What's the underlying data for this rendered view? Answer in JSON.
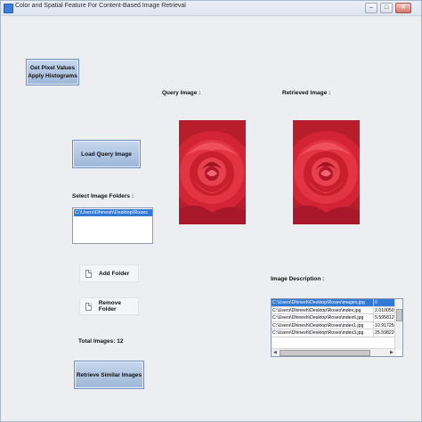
{
  "window": {
    "title": "Color and Spatial Feature For Content-Based Image Retrieval",
    "controls": {
      "minimize": "–",
      "maximize": "□",
      "close": "✕"
    }
  },
  "buttons": {
    "get_pixel_line1": "Get Pixel Values",
    "get_pixel_line2": "Apply Histograms",
    "load_query": "Load Query Image",
    "add_folder": "Add Folder",
    "remove_folder": "Remove Folder",
    "retrieve": "Retrieve Similar Images"
  },
  "labels": {
    "query_image": "Query Image :",
    "retrieved_image": "Retrieved Image :",
    "select_folders": "Select Image Folders :",
    "image_description": "Image Description :",
    "total_images": "Total Images: 12"
  },
  "folders": [
    "C:\\Users\\Dhinesh\\Desktop\\Roses"
  ],
  "description_rows": [
    {
      "path": "C:\\Users\\Dhinesh\\Desktop\\Roses\\images.jpg",
      "value": "0",
      "selected": true
    },
    {
      "path": "C:\\Users\\Dhinesh\\Desktop\\Roses\\index.jpg",
      "value": "2.010050251",
      "selected": false
    },
    {
      "path": "C:\\Users\\Dhinesh\\Desktop\\Roses\\index6.jpg",
      "value": "5.595812995",
      "selected": false
    },
    {
      "path": "C:\\Users\\Dhinesh\\Desktop\\Roses\\index1.jpg",
      "value": "10.9172548",
      "selected": false
    },
    {
      "path": "C:\\Users\\Dhinesh\\Desktop\\Roses\\index3.jpg",
      "value": "25.59822096",
      "selected": false
    }
  ],
  "colors": {
    "button_blue": "#9db6d8",
    "selection_blue": "#3379d6",
    "rose_red": "#c8202e"
  }
}
